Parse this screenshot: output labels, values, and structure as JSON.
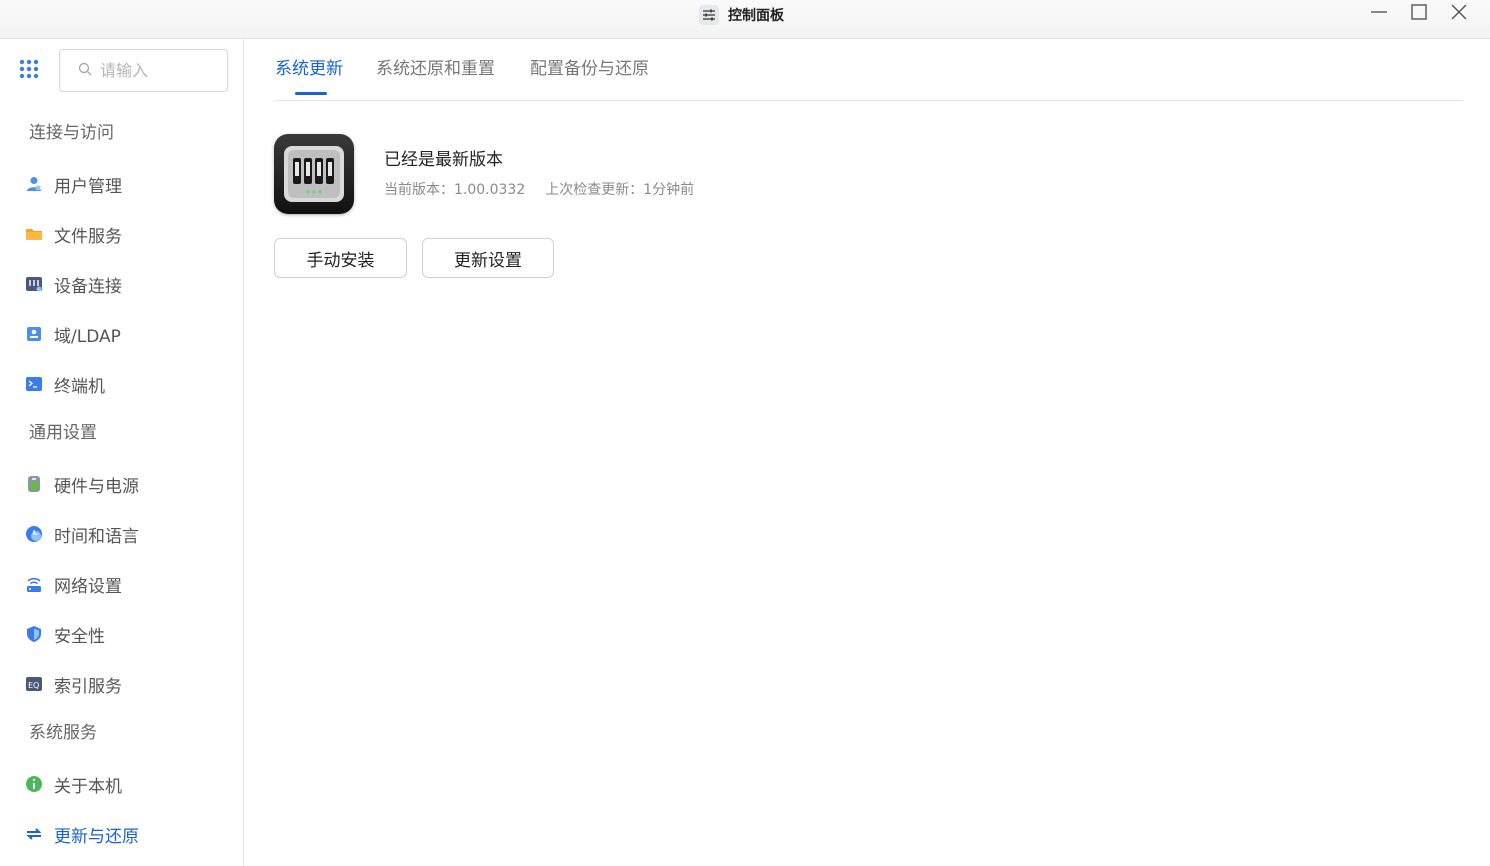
{
  "window": {
    "title": "控制面板",
    "icon": "sliders-icon",
    "controls": [
      "minimize-icon",
      "maximize-icon",
      "close-icon"
    ]
  },
  "sidebar": {
    "search_placeholder": "请输入",
    "groups": [
      {
        "label": "连接与访问"
      },
      {
        "label": "通用设置"
      },
      {
        "label": "系统服务"
      }
    ],
    "items": [
      {
        "label": "用户管理",
        "icon": "user-icon",
        "color": "#4a8ff0"
      },
      {
        "label": "文件服务",
        "icon": "folder-icon",
        "color": "#f5a623"
      },
      {
        "label": "设备连接",
        "icon": "device-icon",
        "color": "#4b5878"
      },
      {
        "label": "域/LDAP",
        "icon": "directory-icon",
        "color": "#4a8ff0"
      },
      {
        "label": "终端机",
        "icon": "terminal-icon",
        "color": "#3b7de8"
      },
      {
        "label": "硬件与电源",
        "icon": "hardware-icon",
        "color": "#6cb844"
      },
      {
        "label": "时间和语言",
        "icon": "clock-icon",
        "color": "#3b7de8"
      },
      {
        "label": "网络设置",
        "icon": "network-icon",
        "color": "#3b7de8"
      },
      {
        "label": "安全性",
        "icon": "shield-icon",
        "color": "#3b7de8"
      },
      {
        "label": "索引服务",
        "icon": "index-icon",
        "color": "#4b5878"
      },
      {
        "label": "关于本机",
        "icon": "info-icon",
        "color": "#4cb85c"
      },
      {
        "label": "更新与还原",
        "icon": "sync-icon",
        "color": "#1862d4",
        "active": true
      }
    ]
  },
  "main": {
    "tabs": [
      {
        "label": "系统更新",
        "active": true
      },
      {
        "label": "系统还原和重置"
      },
      {
        "label": "配置备份与还原"
      }
    ],
    "status_title": "已经是最新版本",
    "current_version": "当前版本：1.00.0332",
    "last_check": "上次检查更新：1分钟前",
    "buttons": {
      "manual_install": "手动安装",
      "update_settings": "更新设置"
    }
  },
  "colors": {
    "accent": "#1862d4",
    "border": "#e3e3e3"
  }
}
